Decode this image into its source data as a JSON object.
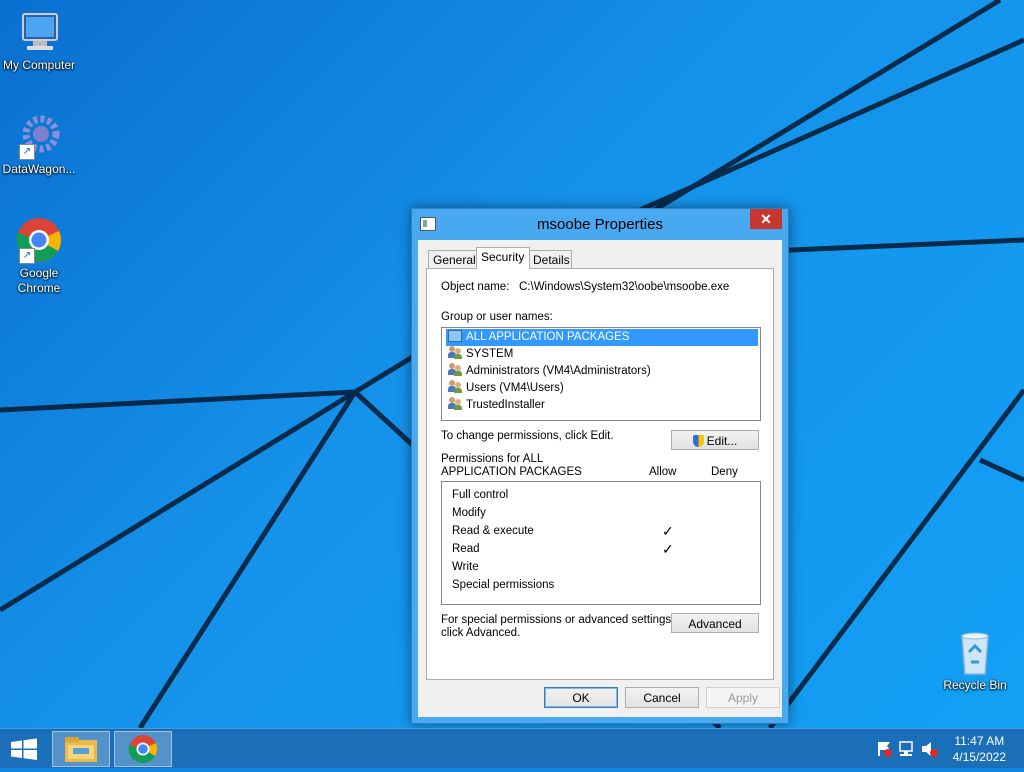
{
  "desktop": {
    "icons": [
      {
        "label": "My Computer"
      },
      {
        "label": "DataWagon..."
      },
      {
        "label": "Google Chrome"
      },
      {
        "label": "Recycle Bin"
      }
    ]
  },
  "dialog": {
    "title": "msoobe Properties",
    "close_glyph": "✕",
    "tabs": [
      {
        "label": "General",
        "active": false
      },
      {
        "label": "Security",
        "active": true
      },
      {
        "label": "Details",
        "active": false
      }
    ],
    "object_name_label": "Object name:",
    "object_name_value": "C:\\Windows\\System32\\oobe\\msoobe.exe",
    "group_label": "Group or user names:",
    "groups": [
      {
        "name": "ALL APPLICATION PACKAGES",
        "selected": true,
        "icon": "package-icon"
      },
      {
        "name": "SYSTEM",
        "selected": false,
        "icon": "users-icon"
      },
      {
        "name": "Administrators (VM4\\Administrators)",
        "selected": false,
        "icon": "users-icon"
      },
      {
        "name": "Users (VM4\\Users)",
        "selected": false,
        "icon": "users-icon"
      },
      {
        "name": "TrustedInstaller",
        "selected": false,
        "icon": "users-icon"
      }
    ],
    "change_text": "To change permissions, click Edit.",
    "edit_label": "Edit...",
    "permissions_for_line1": "Permissions for ALL",
    "permissions_for_line2": "APPLICATION PACKAGES",
    "allow_header": "Allow",
    "deny_header": "Deny",
    "permissions": [
      {
        "name": "Full control",
        "allow": false,
        "deny": false
      },
      {
        "name": "Modify",
        "allow": false,
        "deny": false
      },
      {
        "name": "Read & execute",
        "allow": true,
        "deny": false
      },
      {
        "name": "Read",
        "allow": true,
        "deny": false
      },
      {
        "name": "Write",
        "allow": false,
        "deny": false
      },
      {
        "name": "Special permissions",
        "allow": false,
        "deny": false
      }
    ],
    "check_glyph": "✓",
    "advanced_text_line1": "For special permissions or advanced settings,",
    "advanced_text_line2": "click Advanced.",
    "advanced_label": "Advanced",
    "ok_label": "OK",
    "cancel_label": "Cancel",
    "apply_label": "Apply"
  },
  "taskbar": {
    "time": "11:47 AM",
    "date": "4/15/2022",
    "accent": "#1a6fb8"
  }
}
